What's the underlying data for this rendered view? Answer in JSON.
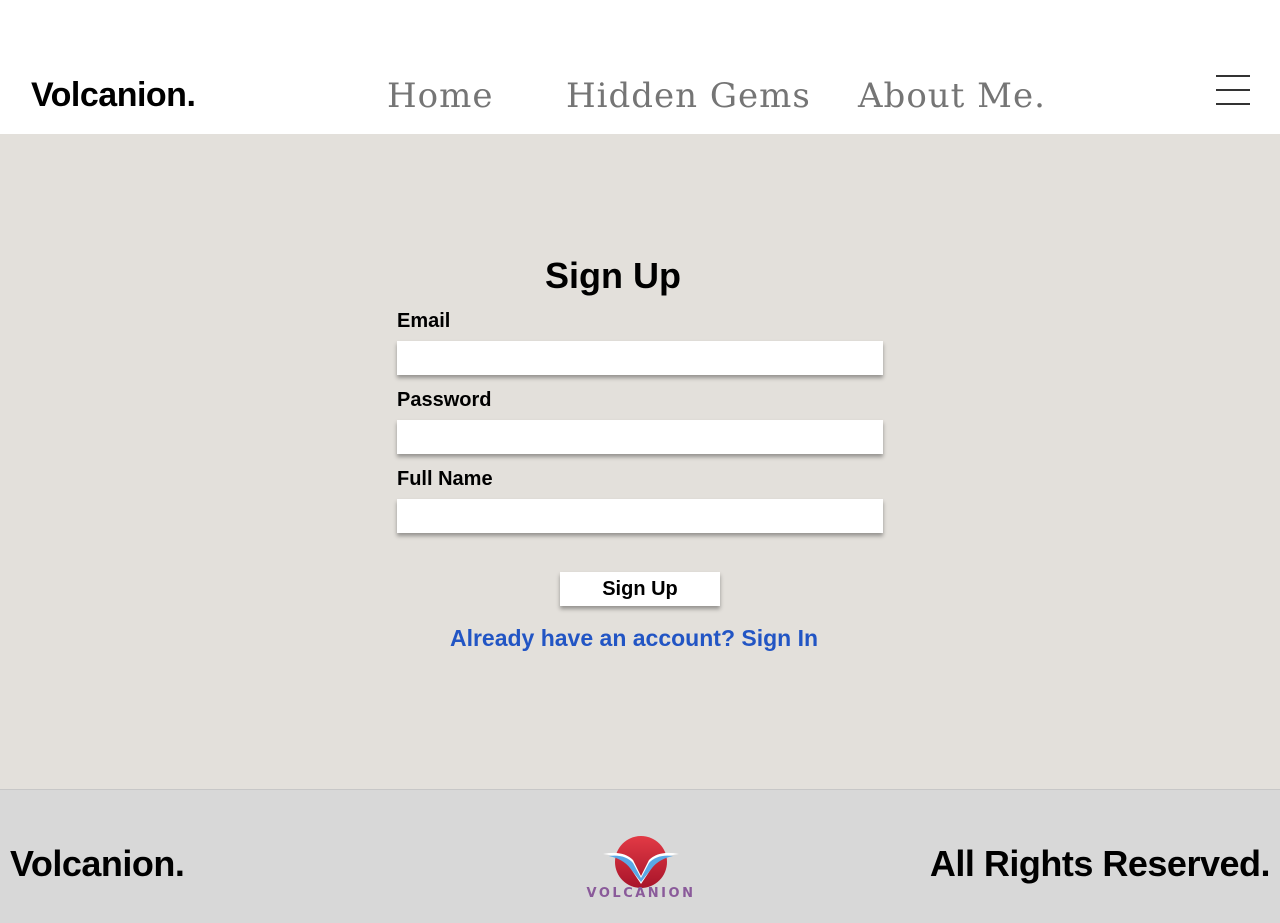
{
  "header": {
    "brand": "Volcanion.",
    "nav": [
      {
        "label": "Home"
      },
      {
        "label": "Hidden Gems"
      },
      {
        "label": "About Me."
      }
    ]
  },
  "form": {
    "title": "Sign Up",
    "fields": {
      "email": {
        "label": "Email",
        "value": ""
      },
      "password": {
        "label": "Password",
        "value": ""
      },
      "full_name": {
        "label": "Full Name",
        "value": ""
      }
    },
    "submit_label": "Sign Up",
    "signin_link": "Already have an account? Sign In"
  },
  "footer": {
    "brand": "Volcanion.",
    "logo_text": "VOLCANION",
    "rights": "All Rights Reserved."
  },
  "colors": {
    "main_bg": "#e3e0db",
    "footer_bg": "#d8d8d8",
    "link": "#2255c4",
    "nav_text": "#757575",
    "logo_red": "#c8202f",
    "logo_blue": "#5aa8e6"
  },
  "icons": {
    "menu": "hamburger-menu-icon",
    "logo": "volcanion-logo"
  }
}
